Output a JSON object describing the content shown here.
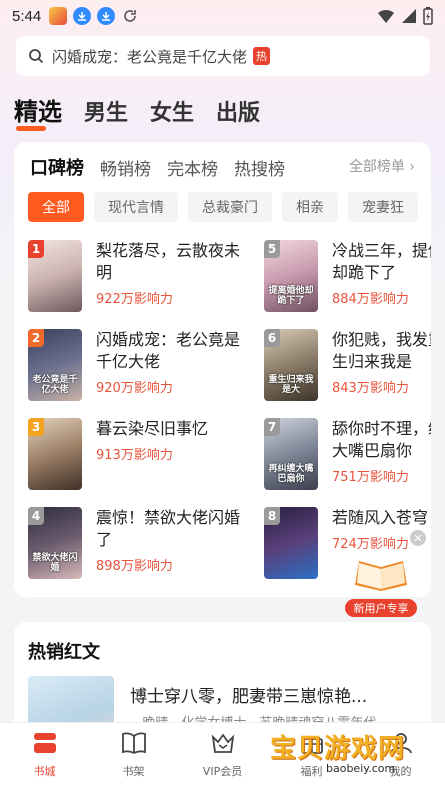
{
  "status_bar": {
    "time": "5:44"
  },
  "search": {
    "text": "闪婚成宠：老公竟是千亿大佬",
    "hot_tag": "热"
  },
  "top_tabs": [
    "精选",
    "男生",
    "女生",
    "出版"
  ],
  "ranking": {
    "tabs": [
      "口碑榜",
      "畅销榜",
      "完本榜",
      "热搜榜"
    ],
    "all_label": "全部榜单 ›",
    "chips": [
      "全部",
      "现代言情",
      "总裁豪门",
      "相亲",
      "宠妻狂"
    ],
    "books": [
      {
        "rank": "1",
        "title": "梨花落尽，云散夜未明",
        "heat": "922万影响力",
        "caption": ""
      },
      {
        "rank": "2",
        "title": "闪婚成宠：老公竟是千亿大佬",
        "heat": "920万影响力",
        "caption": "老公竟是千亿大佬"
      },
      {
        "rank": "3",
        "title": "暮云染尽旧事忆",
        "heat": "913万影响力",
        "caption": ""
      },
      {
        "rank": "4",
        "title": "震惊！禁欲大佬闪婚了",
        "heat": "898万影响力",
        "caption": "禁欲大佬闪婚"
      },
      {
        "rank": "5",
        "title": "冷战三年，提他却跪下了",
        "heat": "884万影响力",
        "caption": "提离婚他却跪下了"
      },
      {
        "rank": "6",
        "title": "你犯贱，我发重生归来我是",
        "heat": "843万影响力",
        "caption": "重生归来我是大"
      },
      {
        "rank": "7",
        "title": "舔你时不理，缠大嘴巴扇你",
        "heat": "751万影响力",
        "caption": "再纠缠大嘴巴扇你"
      },
      {
        "rank": "8",
        "title": "若随风入苍穹",
        "heat": "724万影响力",
        "caption": ""
      }
    ],
    "promo_label": "新用户专享"
  },
  "hot_section": {
    "title": "热销红文",
    "book_title": "博士穿八零，肥妻带三崽惊艳...",
    "book_desc": "...晚晴，化学女博士，苏晚晴魂穿八零年代..."
  },
  "bottom_nav": [
    {
      "label": "书城",
      "icon": "bookstore-icon"
    },
    {
      "label": "书架",
      "icon": "bookshelf-icon"
    },
    {
      "label": "VIP会员",
      "icon": "vip-crown-icon"
    },
    {
      "label": "福利",
      "icon": "gift-icon"
    },
    {
      "label": "我的",
      "icon": "profile-icon"
    }
  ],
  "watermark": {
    "text": "宝贝游戏网",
    "url": "baobeiy.com"
  },
  "colors": {
    "accent": "#ff5a1f",
    "heat": "#e8533c",
    "hot_tag": "#e8422f"
  }
}
